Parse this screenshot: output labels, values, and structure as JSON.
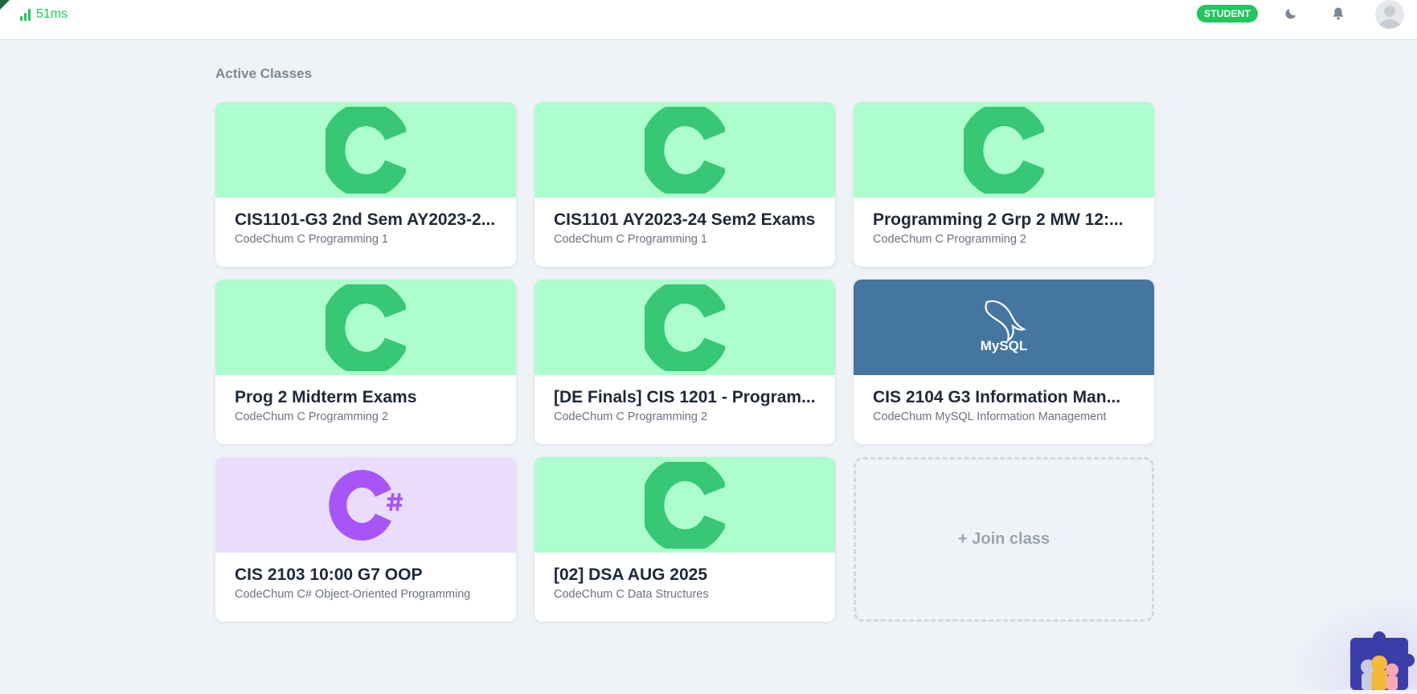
{
  "topbar": {
    "latency": "51ms",
    "role_badge": "STUDENT"
  },
  "section_title": "Active Classes",
  "classes": [
    {
      "title": "CIS1101-G3 2nd Sem AY2023-2...",
      "course": "CodeChum C Programming 1",
      "icon": "c-logo-icon"
    },
    {
      "title": "CIS1101 AY2023-24 Sem2 Exams",
      "course": "CodeChum C Programming 1",
      "icon": "c-logo-icon"
    },
    {
      "title": "Programming 2 Grp 2 MW 12:...",
      "course": "CodeChum C Programming 2",
      "icon": "c-logo-icon"
    },
    {
      "title": "Prog 2 Midterm Exams",
      "course": "CodeChum C Programming 2",
      "icon": "c-logo-icon"
    },
    {
      "title": "[DE Finals] CIS 1201 - Program...",
      "course": "CodeChum C Programming 2",
      "icon": "c-logo-icon"
    },
    {
      "title": "CIS 2104 G3 Information Man...",
      "course": "CodeChum MySQL Information Management",
      "icon": "mysql-logo-icon",
      "logo_text": "MySQL"
    },
    {
      "title": "CIS 2103 10:00 G7 OOP",
      "course": "CodeChum C# Object-Oriented Programming",
      "icon": "csharp-logo-icon"
    },
    {
      "title": "[02] DSA AUG 2025",
      "course": "CodeChum C Data Structures",
      "icon": "c-logo-icon"
    }
  ],
  "join_label": "+ Join class",
  "colors": {
    "accent": "#22c55e",
    "c_banner": "#adfdcd",
    "c_logo": "#38c774",
    "csharp_banner": "#e9dcfd",
    "csharp_logo": "#a855f7",
    "mysql_banner": "#45769f"
  }
}
